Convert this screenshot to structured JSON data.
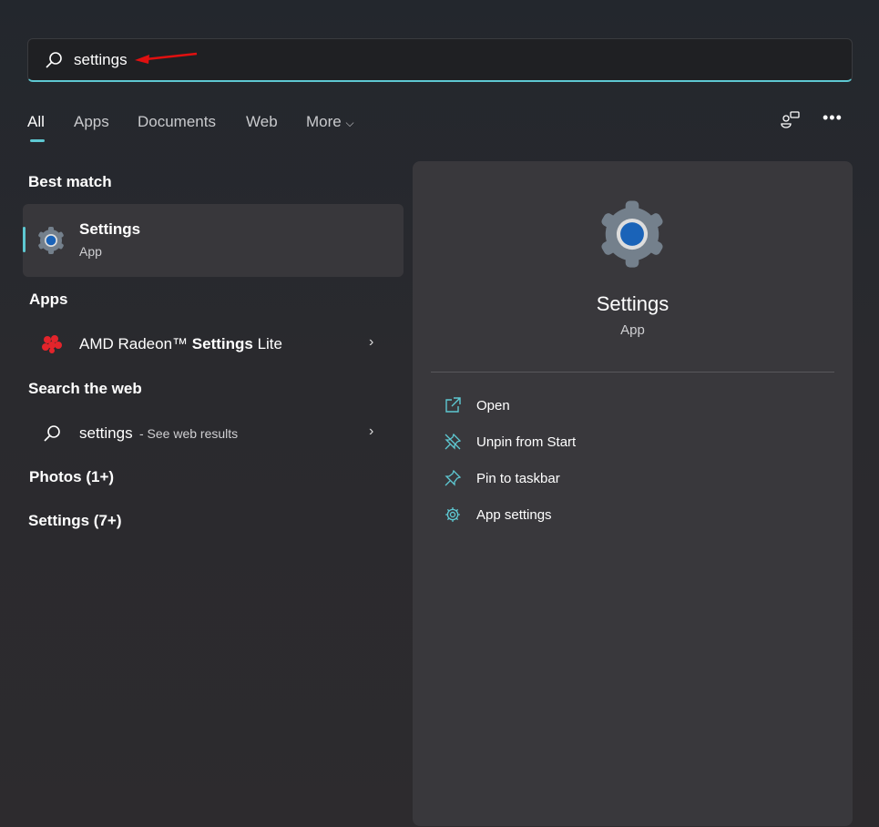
{
  "search": {
    "query": "settings",
    "icon": "search-icon",
    "annotation": "red-arrow-icon"
  },
  "tabs": [
    {
      "label": "All",
      "active": true
    },
    {
      "label": "Apps"
    },
    {
      "label": "Documents"
    },
    {
      "label": "Web"
    },
    {
      "label": "More"
    }
  ],
  "toolbar": {
    "share_icon": "people-chat-icon",
    "more_icon": "ellipsis-icon"
  },
  "best_match": {
    "heading": "Best match",
    "title": "Settings",
    "subtitle": "App",
    "icon": "settings-gear-icon"
  },
  "apps": {
    "heading": "Apps",
    "item": {
      "prefix": "AMD Radeon™ ",
      "bold": "Settings",
      "suffix": " Lite",
      "icon": "amd-radeon-icon"
    }
  },
  "web": {
    "heading": "Search the web",
    "query": "settings",
    "suffix": " - See web results"
  },
  "photos": {
    "heading": "Photos (1+)"
  },
  "settings_group": {
    "heading": "Settings (7+)"
  },
  "preview": {
    "title": "Settings",
    "subtitle": "App",
    "actions": [
      {
        "label": "Open",
        "icon": "open-external-icon"
      },
      {
        "label": "Unpin from Start",
        "icon": "unpin-icon"
      },
      {
        "label": "Pin to taskbar",
        "icon": "pin-icon"
      },
      {
        "label": "App settings",
        "icon": "gear-icon"
      }
    ]
  },
  "colors": {
    "accent": "#5ec8d2",
    "annotation": "#e01010"
  }
}
